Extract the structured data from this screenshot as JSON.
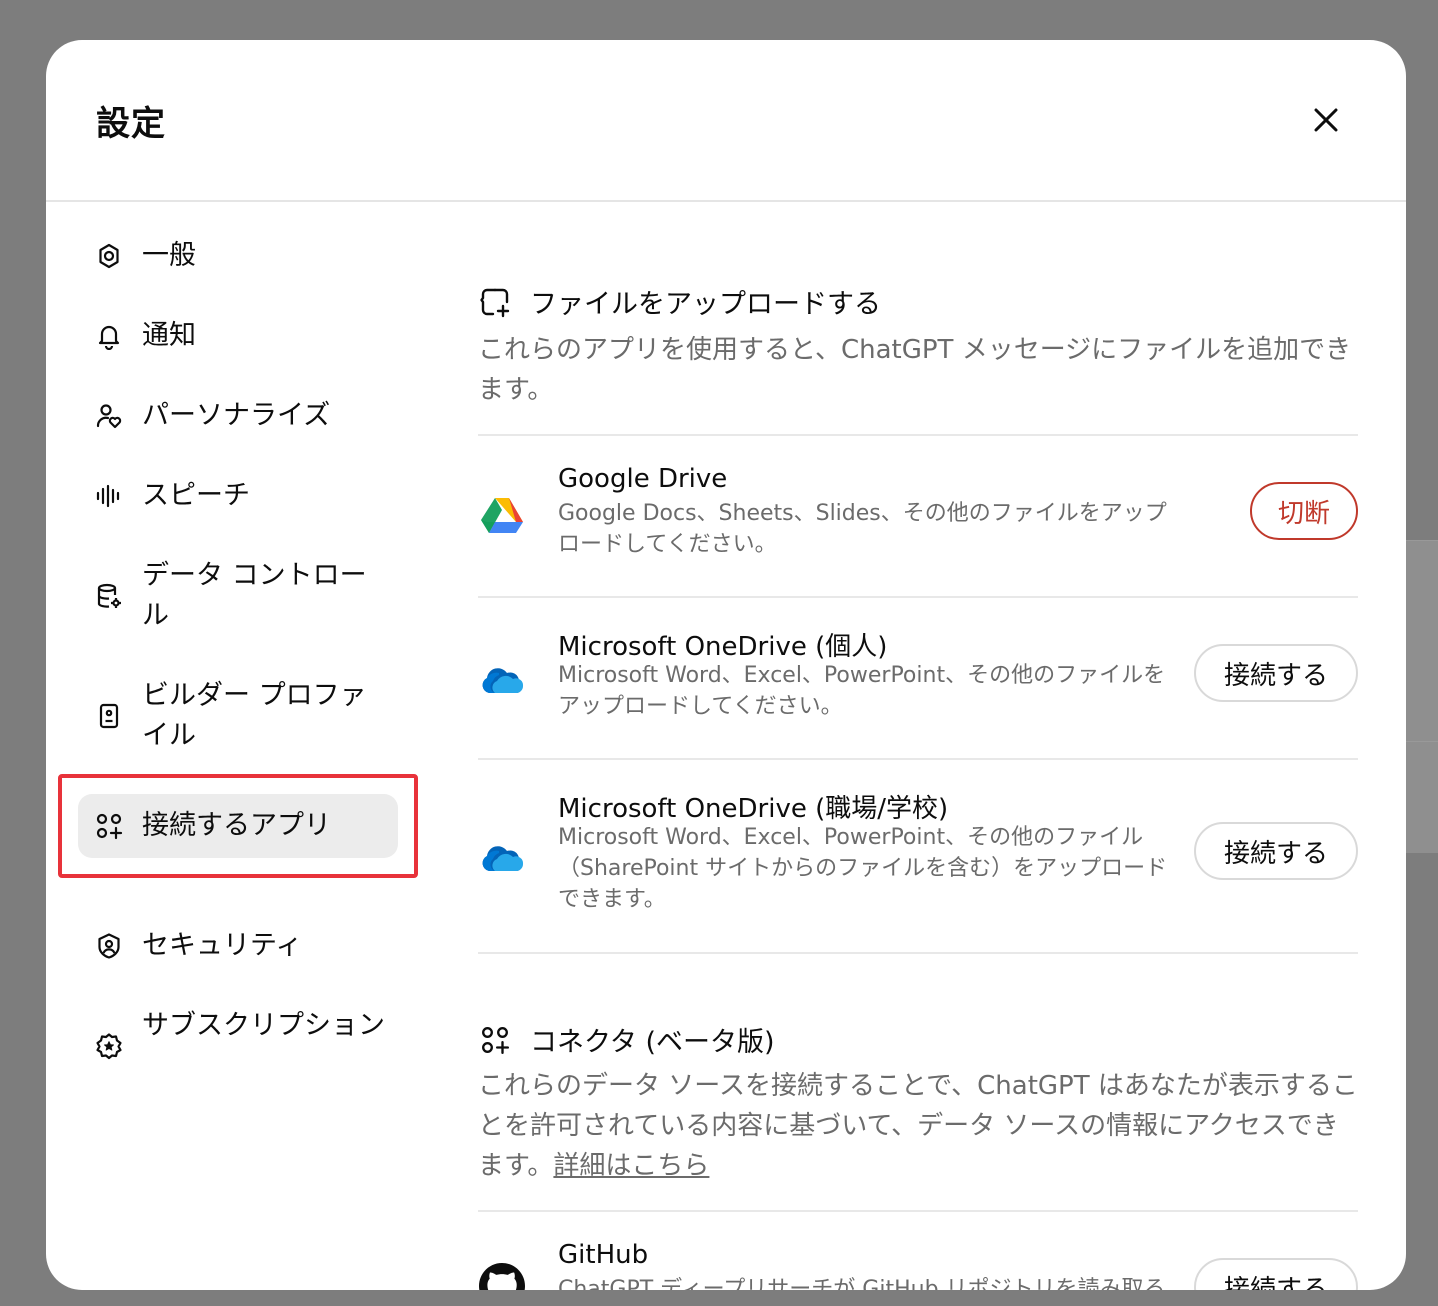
{
  "modal": {
    "title": "設定"
  },
  "sidebar": {
    "items": [
      {
        "label": "一般",
        "icon": "gear-icon"
      },
      {
        "label": "通知",
        "icon": "bell-icon"
      },
      {
        "label": "パーソナライズ",
        "icon": "person-heart-icon"
      },
      {
        "label": "スピーチ",
        "icon": "waveform-icon"
      },
      {
        "label": "データ コントロール",
        "icon": "database-gear-icon"
      },
      {
        "label": "ビルダー プロファイル",
        "icon": "id-card-icon"
      },
      {
        "label": "接続するアプリ",
        "icon": "apps-plus-icon",
        "active": true
      },
      {
        "label": "セキュリティ",
        "icon": "shield-user-icon"
      },
      {
        "label": "サブスクリプション",
        "icon": "badge-star-icon"
      }
    ]
  },
  "upload": {
    "title": "ファイルをアップロードする",
    "description": "これらのアプリを使用すると、ChatGPT メッセージにファイルを追加できます。",
    "apps": [
      {
        "name": "Google Drive",
        "description": "Google Docs、Sheets、Slides、その他のファイルをアップロードしてください。",
        "button": "切断",
        "icon": "google-drive-icon"
      },
      {
        "name": "Microsoft OneDrive (個人)",
        "description": "Microsoft Word、Excel、PowerPoint、その他のファイルをアップロードしてください。",
        "button": "接続する",
        "icon": "onedrive-icon"
      },
      {
        "name": "Microsoft OneDrive (職場/学校)",
        "description": "Microsoft Word、Excel、PowerPoint、その他のファイル（SharePoint サイトからのファイルを含む）をアップロードできます。",
        "button": "接続する",
        "icon": "onedrive-icon"
      }
    ]
  },
  "connectors": {
    "title": "コネクタ (ベータ版)",
    "description": "これらのデータ ソースを接続することで、ChatGPT はあなたが表示することを許可されている内容に基づいて、データ ソースの情報にアクセスできます。",
    "link": "詳細はこちら",
    "apps": [
      {
        "name": "GitHub",
        "description": "ChatGPT ディープリサーチが GitHub リポジトリを読み取ることができるようにします。",
        "button": "接続する",
        "icon": "github-icon"
      }
    ]
  },
  "colors": {
    "accent_danger": "#c0392b",
    "highlight": "#e8323a",
    "active_bg": "#ececec"
  }
}
